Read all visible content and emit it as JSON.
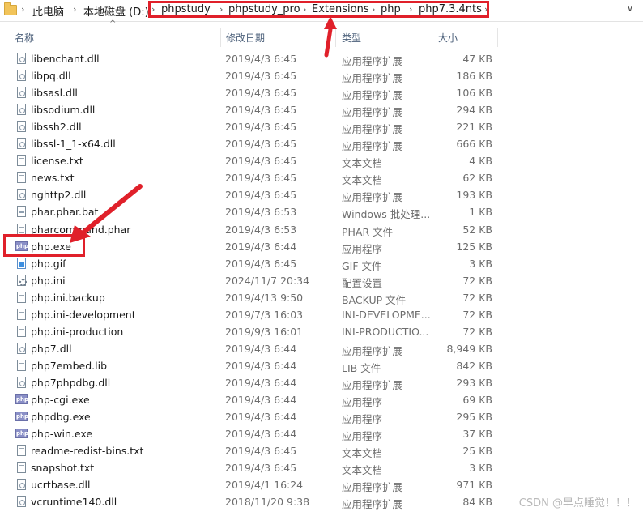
{
  "address": {
    "crumbs": [
      "此电脑",
      "本地磁盘 (D:)",
      "phpstudy",
      "phpstudy_pro",
      "Extensions",
      "php",
      "php7.3.4nts"
    ]
  },
  "columns": {
    "name": "名称",
    "date": "修改日期",
    "type": "类型",
    "size": "大小"
  },
  "files": [
    {
      "name": "libenchant.dll",
      "date": "2019/4/3 6:45",
      "type": "应用程序扩展",
      "size": "47 KB",
      "icon": "dll"
    },
    {
      "name": "libpq.dll",
      "date": "2019/4/3 6:45",
      "type": "应用程序扩展",
      "size": "186 KB",
      "icon": "dll"
    },
    {
      "name": "libsasl.dll",
      "date": "2019/4/3 6:45",
      "type": "应用程序扩展",
      "size": "106 KB",
      "icon": "dll"
    },
    {
      "name": "libsodium.dll",
      "date": "2019/4/3 6:45",
      "type": "应用程序扩展",
      "size": "294 KB",
      "icon": "dll"
    },
    {
      "name": "libssh2.dll",
      "date": "2019/4/3 6:45",
      "type": "应用程序扩展",
      "size": "221 KB",
      "icon": "dll"
    },
    {
      "name": "libssl-1_1-x64.dll",
      "date": "2019/4/3 6:45",
      "type": "应用程序扩展",
      "size": "666 KB",
      "icon": "dll"
    },
    {
      "name": "license.txt",
      "date": "2019/4/3 6:45",
      "type": "文本文档",
      "size": "4 KB",
      "icon": "txt"
    },
    {
      "name": "news.txt",
      "date": "2019/4/3 6:45",
      "type": "文本文档",
      "size": "62 KB",
      "icon": "txt"
    },
    {
      "name": "nghttp2.dll",
      "date": "2019/4/3 6:45",
      "type": "应用程序扩展",
      "size": "193 KB",
      "icon": "dll"
    },
    {
      "name": "phar.phar.bat",
      "date": "2019/4/3 6:53",
      "type": "Windows 批处理...",
      "size": "1 KB",
      "icon": "bat"
    },
    {
      "name": "pharcommand.phar",
      "date": "2019/4/3 6:53",
      "type": "PHAR 文件",
      "size": "52 KB",
      "icon": "txt"
    },
    {
      "name": "php.exe",
      "date": "2019/4/3 6:44",
      "type": "应用程序",
      "size": "125 KB",
      "icon": "php"
    },
    {
      "name": "php.gif",
      "date": "2019/4/3 6:45",
      "type": "GIF 文件",
      "size": "3 KB",
      "icon": "gif"
    },
    {
      "name": "php.ini",
      "date": "2024/11/7 20:34",
      "type": "配置设置",
      "size": "72 KB",
      "icon": "ini"
    },
    {
      "name": "php.ini.backup",
      "date": "2019/4/13 9:50",
      "type": "BACKUP 文件",
      "size": "72 KB",
      "icon": "txt"
    },
    {
      "name": "php.ini-development",
      "date": "2019/7/3 16:03",
      "type": "INI-DEVELOPME...",
      "size": "72 KB",
      "icon": "txt"
    },
    {
      "name": "php.ini-production",
      "date": "2019/9/3 16:01",
      "type": "INI-PRODUCTIO...",
      "size": "72 KB",
      "icon": "txt"
    },
    {
      "name": "php7.dll",
      "date": "2019/4/3 6:44",
      "type": "应用程序扩展",
      "size": "8,949 KB",
      "icon": "dll"
    },
    {
      "name": "php7embed.lib",
      "date": "2019/4/3 6:44",
      "type": "LIB 文件",
      "size": "842 KB",
      "icon": "txt"
    },
    {
      "name": "php7phpdbg.dll",
      "date": "2019/4/3 6:44",
      "type": "应用程序扩展",
      "size": "293 KB",
      "icon": "dll"
    },
    {
      "name": "php-cgi.exe",
      "date": "2019/4/3 6:44",
      "type": "应用程序",
      "size": "69 KB",
      "icon": "php"
    },
    {
      "name": "phpdbg.exe",
      "date": "2019/4/3 6:44",
      "type": "应用程序",
      "size": "295 KB",
      "icon": "php"
    },
    {
      "name": "php-win.exe",
      "date": "2019/4/3 6:44",
      "type": "应用程序",
      "size": "37 KB",
      "icon": "php"
    },
    {
      "name": "readme-redist-bins.txt",
      "date": "2019/4/3 6:45",
      "type": "文本文档",
      "size": "25 KB",
      "icon": "txt"
    },
    {
      "name": "snapshot.txt",
      "date": "2019/4/3 6:45",
      "type": "文本文档",
      "size": "3 KB",
      "icon": "txt"
    },
    {
      "name": "ucrtbase.dll",
      "date": "2019/4/1 16:24",
      "type": "应用程序扩展",
      "size": "971 KB",
      "icon": "dll"
    },
    {
      "name": "vcruntime140.dll",
      "date": "2018/11/20 9:38",
      "type": "应用程序扩展",
      "size": "84 KB",
      "icon": "dll"
    }
  ],
  "icon_labels": {
    "php": "php"
  },
  "watermark": "CSDN @早点睡觉！！！",
  "annotation_color": "#e0202a"
}
